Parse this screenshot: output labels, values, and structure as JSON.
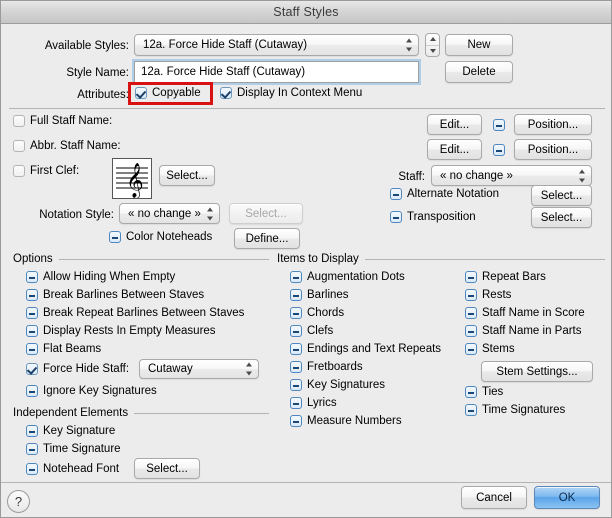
{
  "window": {
    "title": "Staff Styles"
  },
  "top": {
    "available_styles_label": "Available Styles:",
    "available_styles_value": "12a.  Force Hide Staff (Cutaway)",
    "new_button": "New",
    "style_name_label": "Style Name:",
    "style_name_value": "12a.  Force Hide Staff (Cutaway)",
    "delete_button": "Delete",
    "attributes_label": "Attributes:",
    "copyable_label": "Copyable",
    "copyable_state": "on",
    "display_in_context_menu_label": "Display In Context Menu",
    "display_in_context_menu_state": "on",
    "highlight_color": "#d81212"
  },
  "middle": {
    "full_staff_name_label": "Full Staff Name:",
    "full_staff_name_state": "off",
    "abbr_staff_name_label": "Abbr. Staff Name:",
    "abbr_staff_name_state": "off",
    "first_clef_label": "First Clef:",
    "first_clef_state": "off",
    "clef_select_button": "Select...",
    "notation_style_label": "Notation Style:",
    "notation_style_value": "« no change »",
    "notation_style_select_button": "Select...",
    "color_noteheads_label": "Color Noteheads",
    "color_noteheads_state": "mixed",
    "define_button": "Define...",
    "edit_button_1": "Edit...",
    "edit_button_2": "Edit...",
    "position_button_1": "Position...",
    "position_button_2": "Position...",
    "name_box_1_state": "mixed",
    "name_box_2_state": "mixed",
    "staff_label": "Staff:",
    "staff_value": "« no change »",
    "alternate_notation_label": "Alternate Notation",
    "alternate_notation_state": "mixed",
    "alternate_notation_button": "Select...",
    "transposition_label": "Transposition",
    "transposition_state": "mixed",
    "transposition_button": "Select..."
  },
  "options": {
    "group_title": "Options",
    "items": [
      {
        "label": "Allow Hiding When Empty",
        "state": "mixed"
      },
      {
        "label": "Break Barlines Between Staves",
        "state": "mixed"
      },
      {
        "label": "Break Repeat Barlines Between Staves",
        "state": "mixed"
      },
      {
        "label": "Display Rests In Empty Measures",
        "state": "mixed"
      },
      {
        "label": "Flat Beams",
        "state": "mixed"
      },
      {
        "label": "Force Hide Staff:",
        "state": "on"
      },
      {
        "label": "Ignore Key Signatures",
        "state": "mixed"
      }
    ],
    "force_hide_staff_value": "Cutaway"
  },
  "independent_elements": {
    "group_title": "Independent Elements",
    "items": [
      {
        "label": "Key Signature",
        "state": "mixed"
      },
      {
        "label": "Time Signature",
        "state": "mixed"
      },
      {
        "label": "Notehead Font",
        "state": "mixed"
      }
    ],
    "notehead_font_button": "Select..."
  },
  "items_to_display": {
    "group_title": "Items to Display",
    "column_left": [
      {
        "label": "Augmentation Dots",
        "state": "mixed"
      },
      {
        "label": "Barlines",
        "state": "mixed"
      },
      {
        "label": "Chords",
        "state": "mixed"
      },
      {
        "label": "Clefs",
        "state": "mixed"
      },
      {
        "label": "Endings and Text Repeats",
        "state": "mixed"
      },
      {
        "label": "Fretboards",
        "state": "mixed"
      },
      {
        "label": "Key Signatures",
        "state": "mixed"
      },
      {
        "label": "Lyrics",
        "state": "mixed"
      },
      {
        "label": "Measure Numbers",
        "state": "mixed"
      }
    ],
    "column_right": [
      {
        "label": "Repeat Bars",
        "state": "mixed"
      },
      {
        "label": "Rests",
        "state": "mixed"
      },
      {
        "label": "Staff Name in Score",
        "state": "mixed"
      },
      {
        "label": "Staff Name in Parts",
        "state": "mixed"
      },
      {
        "label": "Stems",
        "state": "mixed"
      },
      {
        "label": "Ties",
        "state": "mixed"
      },
      {
        "label": "Time Signatures",
        "state": "mixed"
      }
    ],
    "stem_settings_button": "Stem Settings..."
  },
  "footer": {
    "help_glyph": "?",
    "cancel_button": "Cancel",
    "ok_button": "OK"
  }
}
